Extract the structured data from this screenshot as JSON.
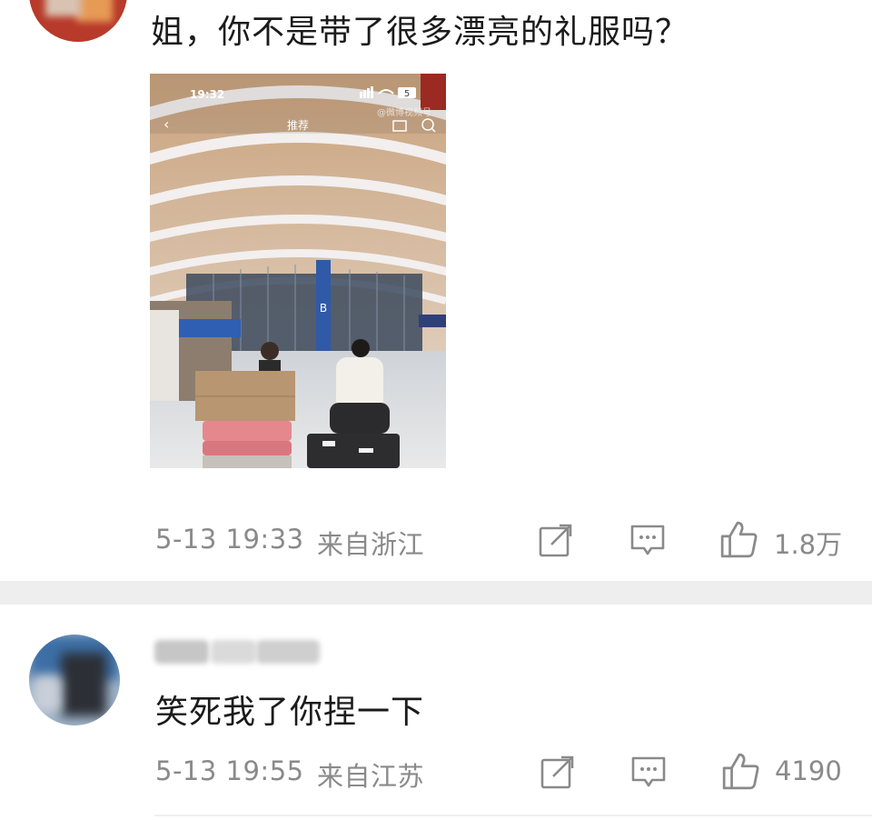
{
  "comments": [
    {
      "text": "姐，你不是带了很多漂亮的礼服吗？",
      "timestamp": "5-13 19:33",
      "location": "来自浙江",
      "likes": "1.8万",
      "image": {
        "status_time": "19:32",
        "status_battery": "5",
        "nav_title": "推荐",
        "watermark": "@微博视频号",
        "gate_label": "B"
      }
    },
    {
      "text": "笑死我了你捏一下",
      "timestamp": "5-13 19:55",
      "location": "来自江苏",
      "likes": "4190"
    }
  ],
  "icons": [
    "repost-icon",
    "comment-icon",
    "like-icon"
  ],
  "colors": {
    "text": "#1b1b1b",
    "meta": "#8a8a8a",
    "divider": "#eeeeee"
  }
}
